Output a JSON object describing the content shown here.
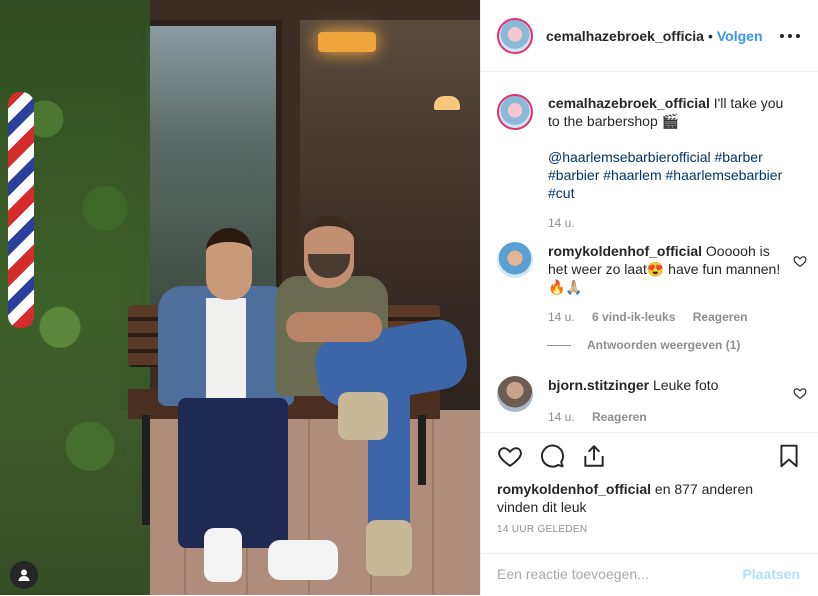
{
  "post": {
    "username": "cemalhazebroek_officia",
    "follow_label": "Volgen",
    "dot": "•"
  },
  "caption": {
    "username": "cemalhazebroek_official",
    "text": " I'll take you to the barbershop 🎬",
    "hashtags": "@haarlemsebarbierofficial #barber #barbier #haarlem #haarlemsebarbier #cut",
    "time": "14 u."
  },
  "comments": [
    {
      "username": "romykoldenhof_official",
      "text": " Oooooh is het weer zo laat😍 have fun mannen! 🔥🙏🏼",
      "time": "14 u.",
      "likes": "6 vind-ik-leuks",
      "reply": "Reageren",
      "view_replies": "Antwoorden weergeven (1)"
    },
    {
      "username": "bjorn.stitzinger",
      "text": " Leuke foto",
      "time": "14 u.",
      "reply": "Reageren"
    }
  ],
  "likes": {
    "user": "romykoldenhof_official",
    "rest": " en 877 anderen",
    "line2": "vinden dit leuk"
  },
  "posted_time": "14 uur geleden",
  "add_comment": {
    "placeholder": "Een reactie toevoegen...",
    "post_label": "Plaatsen"
  },
  "icons": {
    "like": "heart-icon",
    "comment": "comment-icon",
    "share": "share-icon",
    "save": "bookmark-icon",
    "more": "more-icon",
    "tag": "user-tag-icon"
  },
  "colors": {
    "link": "#3897f0",
    "hashtag": "#003569",
    "muted": "#8e8e8e",
    "post_disabled": "#b2dffc"
  }
}
